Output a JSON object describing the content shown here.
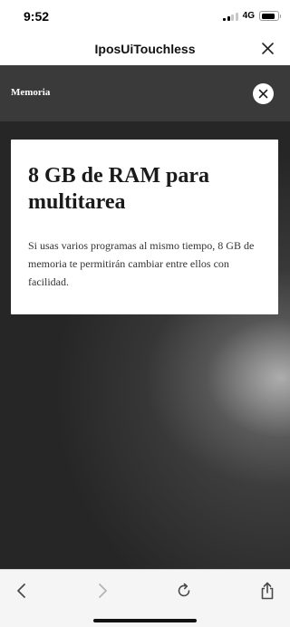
{
  "status_bar": {
    "time": "9:52",
    "network": "4G"
  },
  "header": {
    "title": "IposUiTouchless",
    "close_icon": "close-icon"
  },
  "viewer": {
    "section_label": "Memoria",
    "close_icon": "close-icon"
  },
  "card": {
    "title": "8 GB de RAM para multitarea",
    "body": "Si usas varios programas al mismo tiempo, 8 GB de memoria te permitirán cambiar entre ellos con facilidad."
  },
  "toolbar": {
    "icons": [
      "chevron-left-icon",
      "chevron-right-icon",
      "reload-icon",
      "share-icon"
    ]
  },
  "colors": {
    "viewer_bg": "#262626",
    "viewer_bar": "#3a3a3a",
    "card_bg": "#ffffff",
    "toolbar_bg": "#f5f5f5"
  }
}
